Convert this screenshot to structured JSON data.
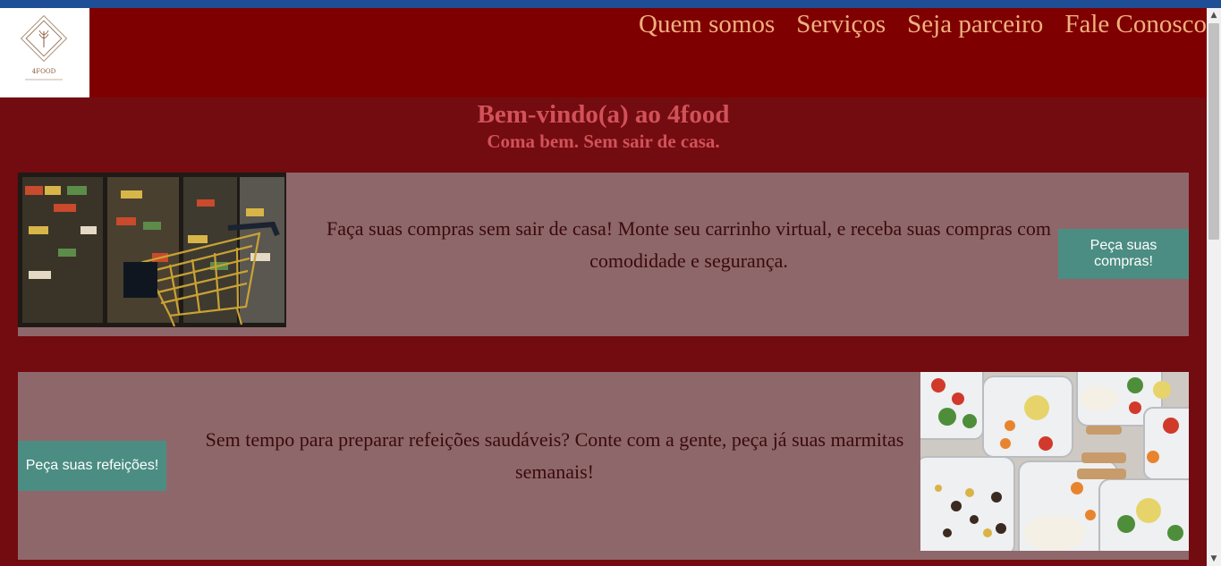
{
  "logo": {
    "text": "4FOOD",
    "alt": "4food logo"
  },
  "nav": {
    "items": [
      {
        "label": "Quem somos"
      },
      {
        "label": "Serviços"
      },
      {
        "label": "Seja parceiro"
      },
      {
        "label": "Fale Conosco"
      }
    ]
  },
  "hero": {
    "title": "Bem-vindo(a) ao 4food",
    "subtitle": "Coma bem. Sem sair de casa."
  },
  "cards": [
    {
      "text": "Faça suas compras sem sair de casa! Monte seu carrinho virtual, e receba suas compras com comodidade e segurança.",
      "button": "Peça suas compras!"
    },
    {
      "text": "Sem tempo para preparar refeições saudáveis? Conte com a gente, peça já suas marmitas semanais!",
      "button": "Peça suas refeições!"
    }
  ],
  "colors": {
    "page_bg": "#720c10",
    "header_bg": "#7f0000",
    "nav_link": "#f0b07e",
    "hero_text": "#d2525a",
    "card_bg": "#8e676b",
    "button_bg": "#4b8d82"
  },
  "scrollbar": {
    "up_icon": "chevron-up-icon",
    "down_icon": "chevron-down-icon"
  }
}
